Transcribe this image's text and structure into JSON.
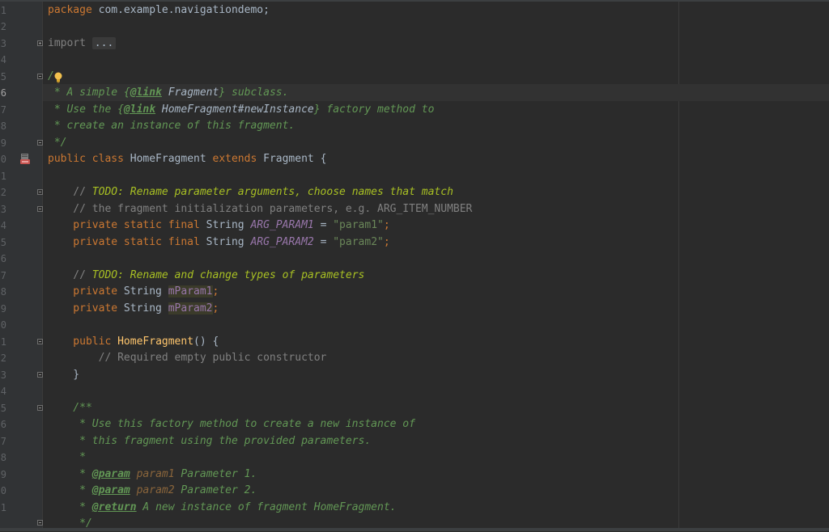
{
  "editor": {
    "line_numbers": [
      "1",
      "2",
      "3",
      "4",
      "5",
      "6",
      "7",
      "8",
      "9",
      "0",
      "1",
      "2",
      "3",
      "4",
      "5",
      "6",
      "7",
      "8",
      "9",
      "0",
      "1",
      "2",
      "3",
      "4",
      "5",
      "6",
      "7",
      "8",
      "9",
      "0",
      "1"
    ],
    "code": {
      "package_kw": "package",
      "package_name": " com.example.navigationdemo;",
      "import_kw": "import",
      "import_folded": "...",
      "doc_open": "/",
      "l5_a": " * A simple {",
      "l5_tag": "@link",
      "l5_ref": " Fragment",
      "l5_b": "} subclass.",
      "l6_a": " * Use the {",
      "l6_tag": "@link",
      "l6_ref": " HomeFragment#newInstance",
      "l6_b": "} factory method to",
      "l7": " * create an instance of this fragment.",
      "l8": " */",
      "l9_kw": "public class",
      "l9_name": " HomeFragment ",
      "l9_ext": "extends",
      "l9_rest": " Fragment {",
      "l11_slash": "    // ",
      "l11_todo": "TODO: Rename parameter arguments, choose names that match",
      "l12": "    // the fragment initialization parameters, e.g. ARG_ITEM_NUMBER",
      "l13_kw": "    private static final",
      "l13_type": " String ",
      "l13_const": "ARG_PARAM1",
      "l13_eq": " = ",
      "l13_str": "\"param1\"",
      "l13_semi": ";",
      "l14_kw": "    private static final",
      "l14_type": " String ",
      "l14_const": "ARG_PARAM2",
      "l14_eq": " = ",
      "l14_str": "\"param2\"",
      "l14_semi": ";",
      "l16_slash": "    // ",
      "l16_todo": "TODO: Rename and change types of parameters",
      "l17_kw": "    private",
      "l17_type": " String ",
      "l17_field": "mParam1",
      "l17_semi": ";",
      "l18_kw": "    private",
      "l18_type": " String ",
      "l18_field": "mParam2",
      "l18_semi": ";",
      "l20_kw": "    public",
      "l20_method": " HomeFragment",
      "l20_rest": "() {",
      "l21": "        // Required empty public constructor",
      "l22": "    }",
      "l24": "    /**",
      "l25": "     * Use this factory method to create a new instance of",
      "l26": "     * this fragment using the provided parameters.",
      "l27": "     *",
      "l28_a": "     * ",
      "l28_tag": "@param",
      "l28_p": " param1",
      "l28_b": " Parameter 1.",
      "l29_a": "     * ",
      "l29_tag": "@param",
      "l29_p": " param2",
      "l29_b": " Parameter 2.",
      "l30_a": "     * ",
      "l30_tag": "@return",
      "l30_b": " A new instance of fragment HomeFragment.",
      "l31": "     */"
    }
  },
  "icons": {
    "intention_bulb": "lightbulb-icon",
    "class_gutter": "android-class-icon"
  },
  "colors": {
    "background": "#2b2b2b",
    "keyword": "#cc7832",
    "string": "#6a8759",
    "doc_comment": "#629755",
    "todo": "#a8c023",
    "line_comment": "#808080",
    "constant": "#9876aa",
    "method_decl": "#ffc66d"
  }
}
